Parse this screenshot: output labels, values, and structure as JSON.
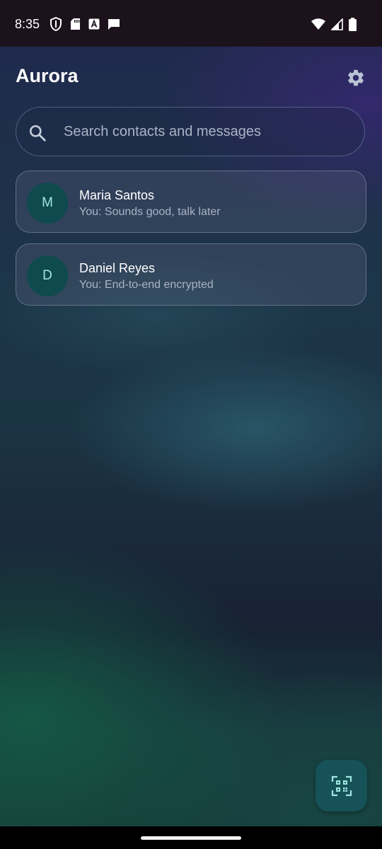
{
  "status_bar": {
    "time": "8:35",
    "left_icons": [
      "shield-icon",
      "sd-card-icon",
      "font-a-icon",
      "message-icon"
    ],
    "right_icons": [
      "wifi-icon",
      "signal-icon",
      "battery-icon"
    ]
  },
  "app": {
    "title": "Aurora",
    "settings_icon": "gear-icon"
  },
  "search": {
    "placeholder": "Search contacts and messages",
    "value": "",
    "icon": "search-icon"
  },
  "conversations": [
    {
      "initial": "M",
      "name": "Maria Santos",
      "preview": "You: Sounds good, talk later"
    },
    {
      "initial": "D",
      "name": "Daniel Reyes",
      "preview": "You: End-to-end encrypted"
    }
  ],
  "fab": {
    "icon": "qr-scan-icon"
  },
  "colors": {
    "accent": "#9fe6e2",
    "avatar_bg": "#0e4a4e",
    "fab_bg": "#165257",
    "text_primary": "#ffffff",
    "text_secondary": "#aab4c4"
  }
}
